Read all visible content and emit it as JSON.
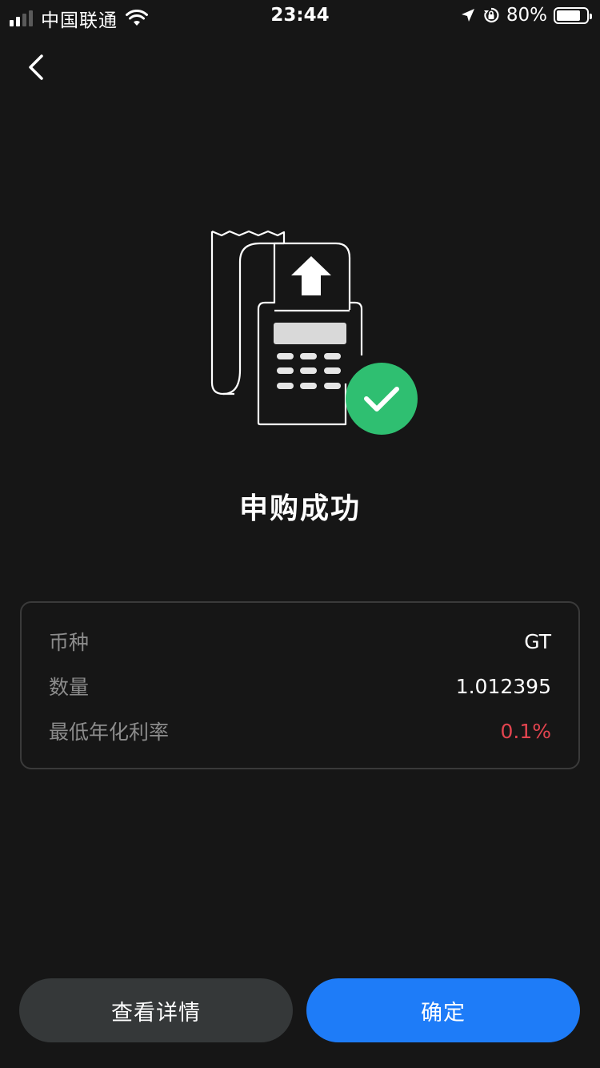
{
  "status_bar": {
    "carrier": "中国联通",
    "time": "23:44",
    "battery_percent": "80%",
    "battery_level": 0.8,
    "signal_bars": 2
  },
  "nav": {
    "back_icon": "chevron-left-icon"
  },
  "illustration": {
    "icon": "pos-terminal-receipt-icon",
    "badge_icon": "check-icon",
    "badge_color": "#2fbf71"
  },
  "result": {
    "title": "申购成功"
  },
  "details": [
    {
      "label": "币种",
      "value": "GT"
    },
    {
      "label": "数量",
      "value": "1.012395"
    },
    {
      "label": "最低年化利率",
      "value": "0.1%",
      "color": "#e2444f"
    }
  ],
  "buttons": {
    "view_details": "查看详情",
    "confirm": "确定",
    "primary_color": "#1e7cf8",
    "secondary_color": "#353839"
  }
}
